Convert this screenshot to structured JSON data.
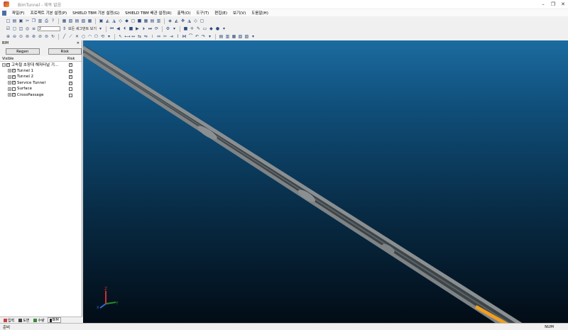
{
  "window": {
    "title": "BimTunnel - 제목 없음"
  },
  "menu": [
    "파일(F)",
    "프로젝트 기본 설정(P)",
    "SHIELD TBM 기본 설정(G)",
    "SHIELD TBM 배관 설정(R)",
    "출력(O)",
    "도구(T)",
    "편집(E)",
    "보기(V)",
    "도움말(H)"
  ],
  "toolbar": {
    "input_value": "2",
    "segment_label": "모든 세그먼트 보기"
  },
  "panel": {
    "title": "BIM",
    "pin_glyph": "✕",
    "regen_label": "Regen",
    "risk_label": "Risk",
    "col_visible": "Visible",
    "col_risk": "Risk",
    "tree": [
      {
        "label": "고속철 초장대 해저터널 기...",
        "visible": true,
        "risk": true
      },
      {
        "label": "Tunnel 1",
        "visible": true,
        "risk": true
      },
      {
        "label": "Tunnel 2",
        "visible": true,
        "risk": true
      },
      {
        "label": "Service Tunnel",
        "visible": true,
        "risk": true
      },
      {
        "label": "Surface",
        "visible": false,
        "risk": false
      },
      {
        "label": "CrossPassage",
        "visible": true,
        "risk": false
      }
    ]
  },
  "bottom_tabs": [
    "입력",
    "도면",
    "수량",
    "BIM"
  ],
  "axes": {
    "x": "X",
    "y": "Y",
    "z": "Z"
  },
  "status": {
    "left": "준비",
    "right": "NUM"
  },
  "colors": {
    "viewport_top": "#1b6ba0",
    "viewport_bottom": "#020c16",
    "tunnel": "#8a8f92",
    "highlight": "#f0a020"
  }
}
